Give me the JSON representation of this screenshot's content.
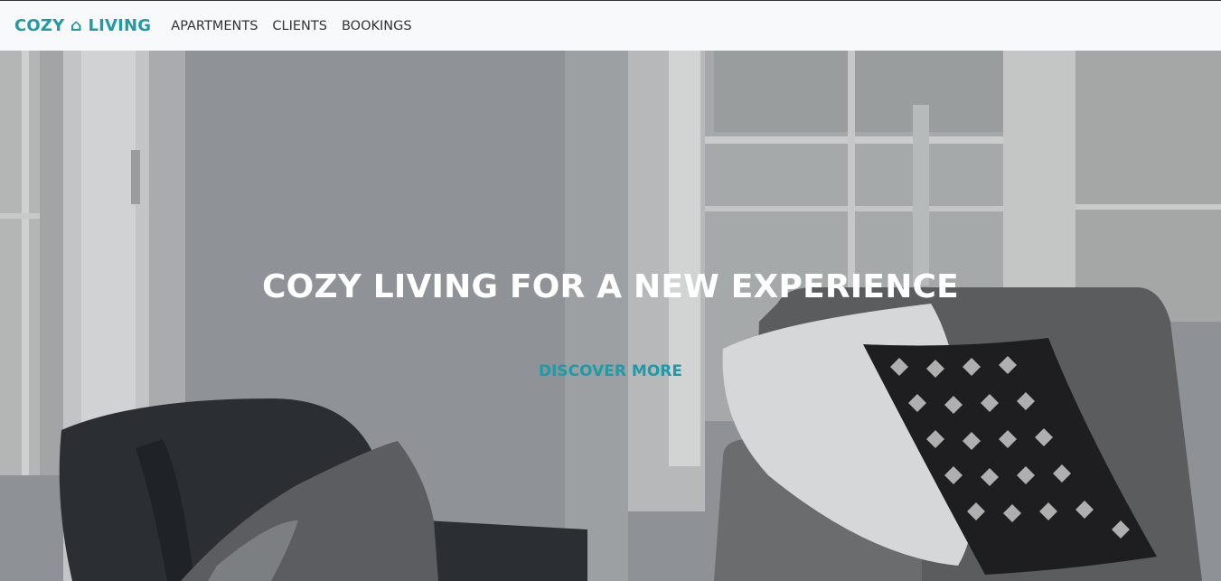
{
  "navbar": {
    "brand_left": "COZY",
    "brand_icon": "home-icon",
    "brand_right": "LIVING",
    "links": [
      "APARTMENTS",
      "CLIENTS",
      "BOOKINGS"
    ]
  },
  "hero": {
    "title": "COZY LIVING FOR A NEW EXPERIENCE",
    "cta_label": "DISCOVER MORE",
    "background_image": "living-room-photo"
  },
  "colors": {
    "accent": "#1f9aa7",
    "navbar_bg": "#f8f9fa",
    "nav_text": "#333333",
    "hero_text": "#ffffff"
  }
}
